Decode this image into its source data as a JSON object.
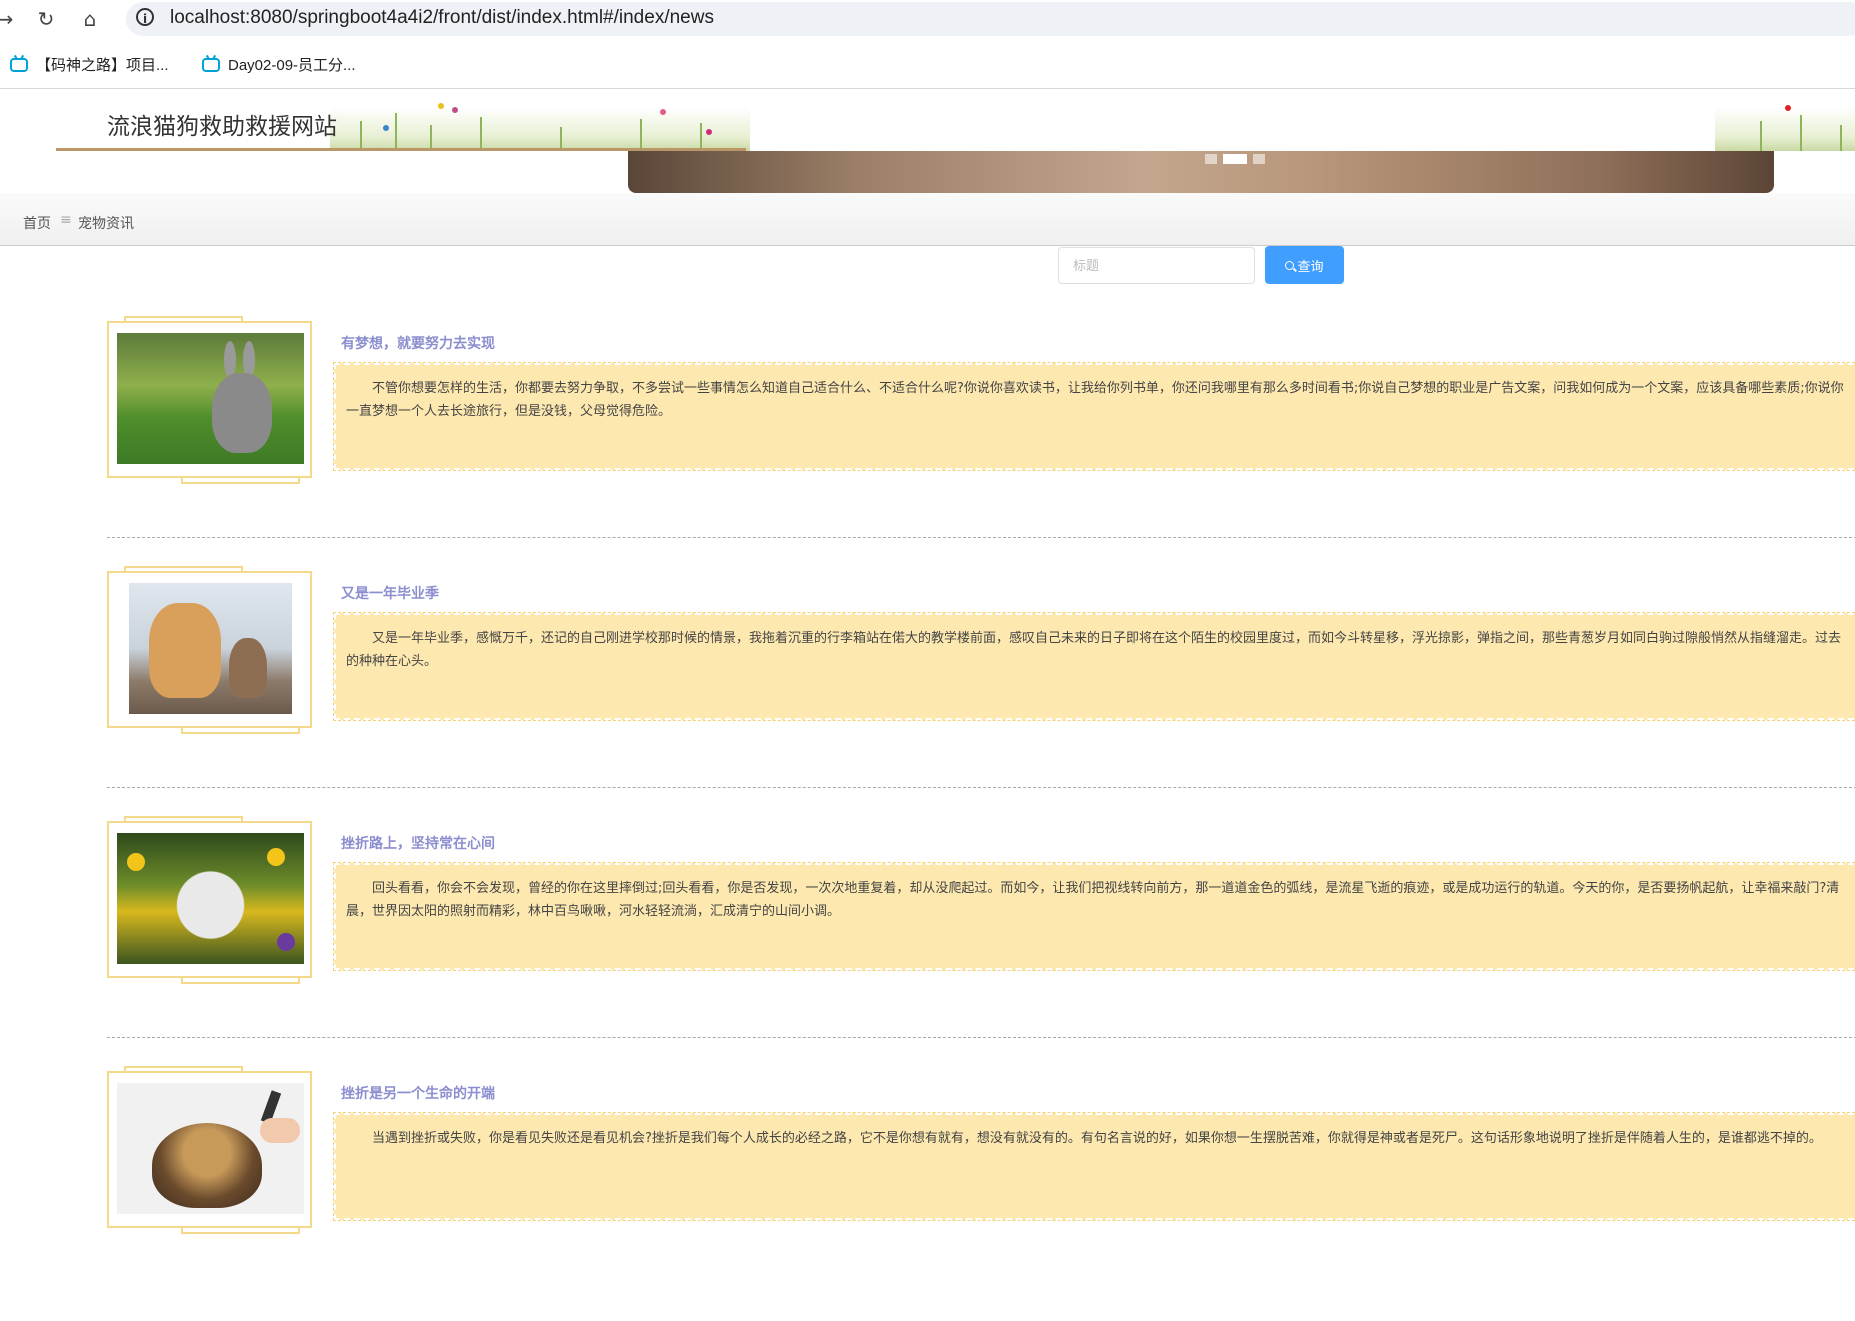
{
  "browser": {
    "url": "localhost:8080/springboot4a4i2/front/dist/index.html#/index/news",
    "bookmarks": [
      {
        "label": "【码神之路】项目..."
      },
      {
        "label": "Day02-09-员工分..."
      }
    ]
  },
  "site": {
    "title": "流浪猫狗救助救援网站"
  },
  "breadcrumb": {
    "home": "首页",
    "separator": "≡",
    "current": "宠物资讯"
  },
  "search": {
    "placeholder": "标题",
    "button_label": "查询"
  },
  "news": [
    {
      "title": "有梦想，就要努力去实现",
      "image": "rabbit-photo",
      "content": "不管你想要怎样的生活，你都要去努力争取，不多尝试一些事情怎么知道自己适合什么、不适合什么呢?你说你喜欢读书，让我给你列书单，你还问我哪里有那么多时间看书;你说自己梦想的职业是广告文案，问我如何成为一个文案，应该具备哪些素质;你说你一直梦想一个人去长途旅行，但是没钱，父母觉得危险。"
    },
    {
      "title": "又是一年毕业季",
      "image": "dog-and-cat-photo",
      "content": "又是一年毕业季，感慨万千，还记的自己刚进学校那时候的情景，我拖着沉重的行李箱站在偌大的教学楼前面，感叹自己未来的日子即将在这个陌生的校园里度过，而如今斗转星移，浮光掠影，弹指之间，那些青葱岁月如同白驹过隙般悄然从指缝溜走。过去的种种在心头。"
    },
    {
      "title": "挫折路上，坚持常在心间",
      "image": "kitten-in-flowers-photo",
      "content": "回头看看，你会不会发现，曾经的你在这里摔倒过;回头看看，你是否发现，一次次地重复着，却从没爬起过。而如今，让我们把视线转向前方，那一道道金色的弧线，是流星飞逝的痕迹，或是成功运行的轨道。今天的你，是否要扬帆起航，让幸福来敲门?清晨，世界因太阳的照射而精彩，林中百鸟啾啾，河水轻轻流淌，汇成清宁的山间小调。"
    },
    {
      "title": "挫折是另一个生命的开端",
      "image": "dog-grooming-photo",
      "content": "当遇到挫折或失败，你是看见失败还是看见机会?挫折是我们每个人成长的必经之路，它不是你想有就有，想没有就没有的。有句名言说的好，如果你想一生摆脱苦难，你就得是神或者是死尸。这句话形象地说明了挫折是伴随着人生的，是谁都逃不掉的。"
    }
  ]
}
